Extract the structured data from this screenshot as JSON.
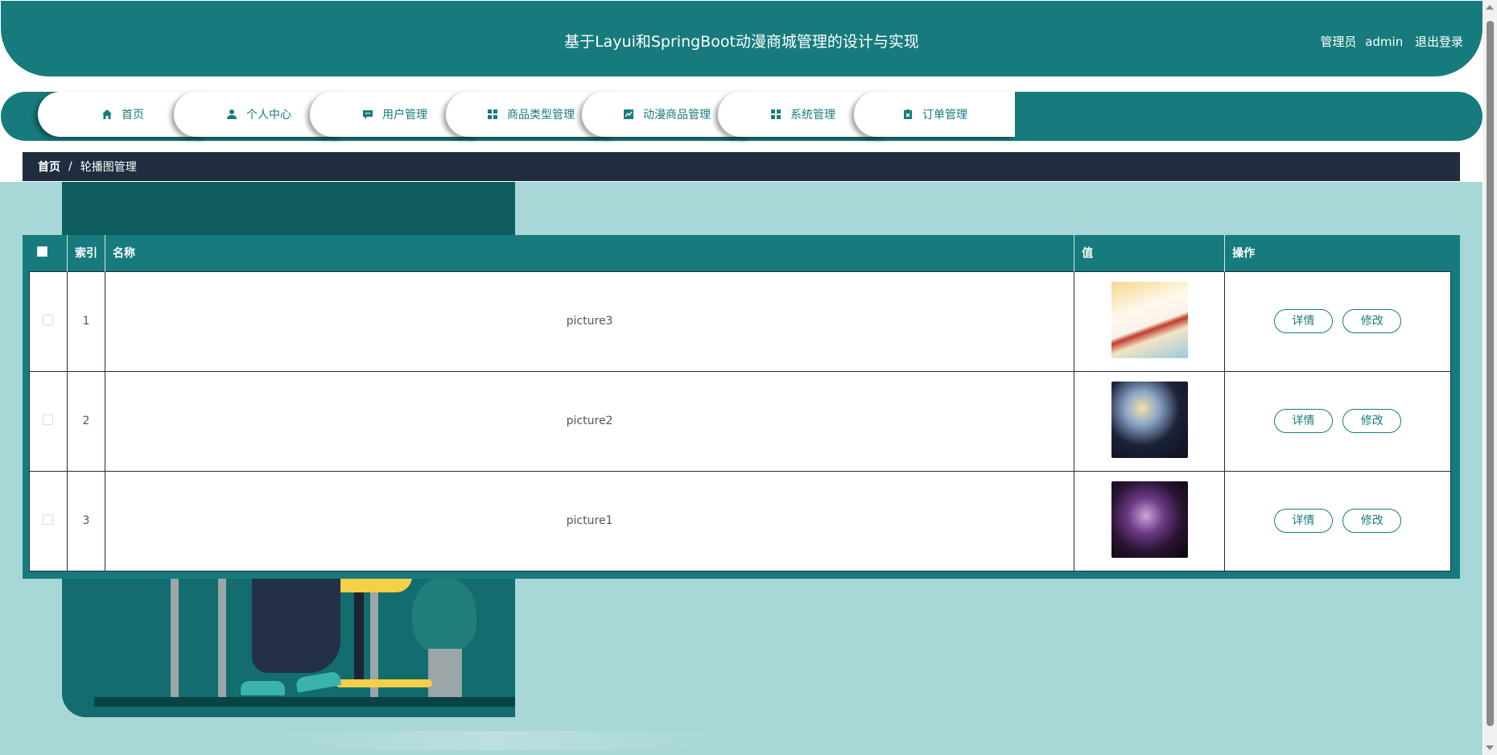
{
  "header": {
    "title": "基于Layui和SpringBoot动漫商城管理的设计与实现",
    "user_role": "管理员",
    "user_name": "admin",
    "logout": "退出登录"
  },
  "nav": {
    "items": [
      {
        "label": "首页",
        "icon": "home-icon"
      },
      {
        "label": "个人中心",
        "icon": "user-icon"
      },
      {
        "label": "用户管理",
        "icon": "chat-icon"
      },
      {
        "label": "商品类型管理",
        "icon": "grid-icon"
      },
      {
        "label": "动漫商品管理",
        "icon": "chart-icon"
      },
      {
        "label": "系统管理",
        "icon": "grid-icon"
      },
      {
        "label": "订单管理",
        "icon": "clipboard-icon"
      }
    ]
  },
  "breadcrumb": {
    "home": "首页",
    "separator": "/",
    "current": "轮播图管理"
  },
  "table": {
    "headers": {
      "index": "索引",
      "name": "名称",
      "value": "值",
      "actions": "操作"
    },
    "rows": [
      {
        "index": "1",
        "name": "picture3",
        "detail": "详情",
        "edit": "修改"
      },
      {
        "index": "2",
        "name": "picture2",
        "detail": "详情",
        "edit": "修改"
      },
      {
        "index": "3",
        "name": "picture1",
        "detail": "详情",
        "edit": "修改"
      }
    ]
  },
  "colors": {
    "primary": "#177b7d",
    "dark_bar": "#1f2d3f",
    "content_bg": "#a7d7d7"
  }
}
